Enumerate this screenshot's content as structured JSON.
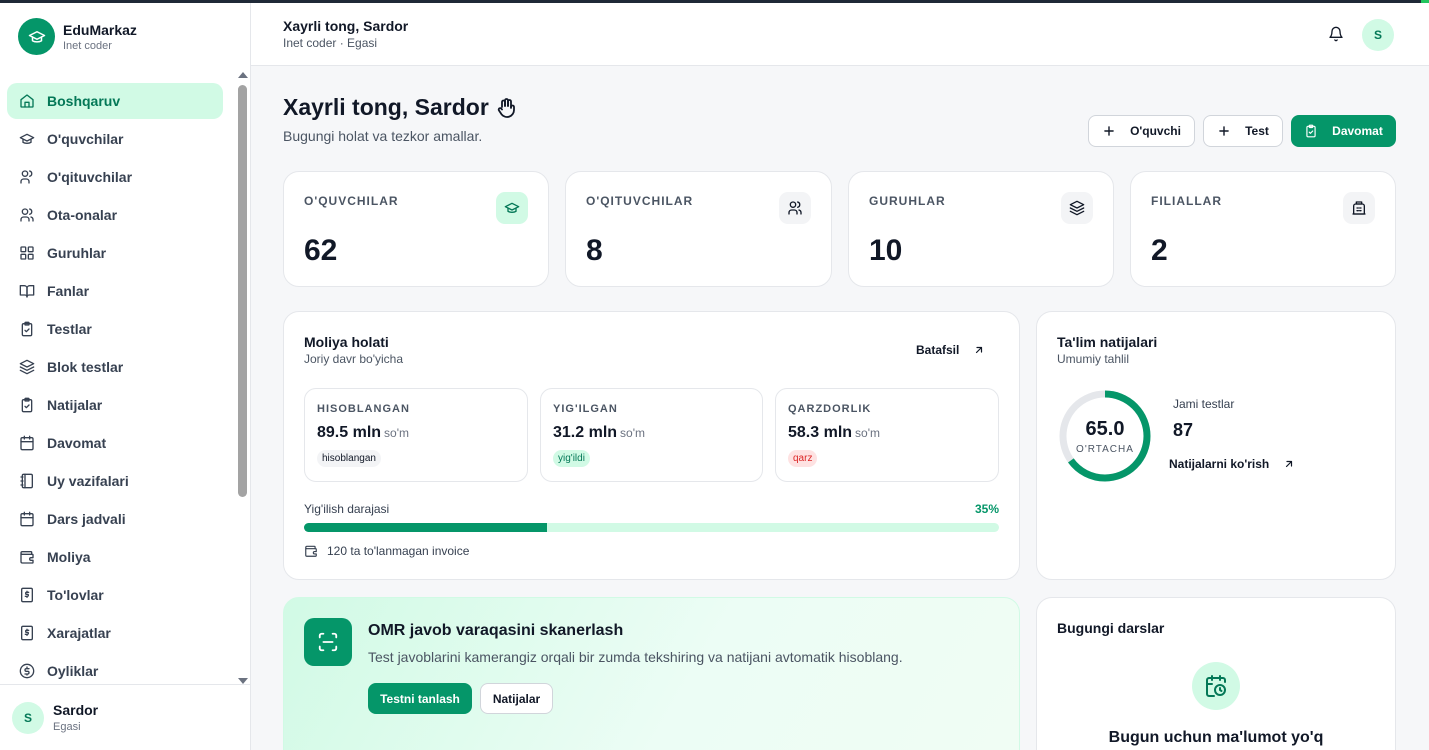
{
  "brand": {
    "name": "EduMarkaz",
    "subtitle": "Inet coder"
  },
  "sidebar": {
    "items": [
      {
        "label": "Boshqaruv",
        "icon": "home-icon",
        "active": true
      },
      {
        "label": "O'quvchilar",
        "icon": "graduation-cap-icon"
      },
      {
        "label": "O'qituvchilar",
        "icon": "user-icon"
      },
      {
        "label": "Ota-onalar",
        "icon": "users-icon"
      },
      {
        "label": "Guruhlar",
        "icon": "grid-icon"
      },
      {
        "label": "Fanlar",
        "icon": "book-open-icon"
      },
      {
        "label": "Testlar",
        "icon": "clipboard-check-icon"
      },
      {
        "label": "Blok testlar",
        "icon": "layers-icon"
      },
      {
        "label": "Natijalar",
        "icon": "clipboard-check-icon"
      },
      {
        "label": "Davomat",
        "icon": "calendar-icon"
      },
      {
        "label": "Uy vazifalari",
        "icon": "notebook-icon"
      },
      {
        "label": "Dars jadvali",
        "icon": "calendar-icon"
      },
      {
        "label": "Moliya",
        "icon": "wallet-icon"
      },
      {
        "label": "To'lovlar",
        "icon": "receipt-dollar-icon"
      },
      {
        "label": "Xarajatlar",
        "icon": "receipt-dollar-icon"
      },
      {
        "label": "Oyliklar",
        "icon": "dollar-circle-icon"
      }
    ]
  },
  "user": {
    "name": "Sardor",
    "role": "Egasi",
    "initial": "S"
  },
  "topbar": {
    "title": "Xayrli tong, Sardor",
    "subtitle": "Inet coder · Egasi"
  },
  "page": {
    "greeting": "Xayrli tong, Sardor",
    "subtitle": "Bugungi holat va tezkor amallar."
  },
  "actions": {
    "add_student": "O'quvchi",
    "add_test": "Test",
    "attendance": "Davomat"
  },
  "stats": [
    {
      "label": "O'QUVCHILAR",
      "value": "62",
      "icon": "graduation-cap-icon"
    },
    {
      "label": "O'QITUVCHILAR",
      "value": "8",
      "icon": "users-icon"
    },
    {
      "label": "GURUHLAR",
      "value": "10",
      "icon": "layers-icon"
    },
    {
      "label": "FILIALLAR",
      "value": "2",
      "icon": "building-icon"
    }
  ],
  "finance": {
    "title": "Moliya holati",
    "subtitle": "Joriy davr bo'yicha",
    "details": "Batafsil",
    "boxes": [
      {
        "label": "HISOBLANGAN",
        "value": "89.5 mln",
        "unit": "so'm",
        "tag": "hisoblangan"
      },
      {
        "label": "YIG'ILGAN",
        "value": "31.2 mln",
        "unit": "so'm",
        "tag": "yig'ildi"
      },
      {
        "label": "QARZDORLIK",
        "value": "58.3 mln",
        "unit": "so'm",
        "tag": "qarz"
      }
    ],
    "progress_label": "Yig'ilish darajasi",
    "progress_pct": "35%",
    "progress_value": 35,
    "invoice_note": "120 ta to'lanmagan invoice"
  },
  "education": {
    "title": "Ta'lim natijalari",
    "subtitle": "Umumiy tahlil",
    "average": "65.0",
    "average_label": "O'RTACHA",
    "average_value": 65,
    "tests_label": "Jami testlar",
    "tests_value": "87",
    "link": "Natijalarni ko'rish"
  },
  "omr": {
    "title": "OMR javob varaqasini skanerlash",
    "description": "Test javoblarini kamerangiz orqali bir zumda tekshiring va natijani avtomatik hisoblang.",
    "primary": "Testni tanlash",
    "secondary": "Natijalar"
  },
  "lessons": {
    "title": "Bugungi darslar",
    "empty": "Bugun uchun ma'lumot yo'q"
  },
  "colors": {
    "accent": "#059669",
    "accent_light": "#d1fae5",
    "danger": "#dc2626"
  }
}
